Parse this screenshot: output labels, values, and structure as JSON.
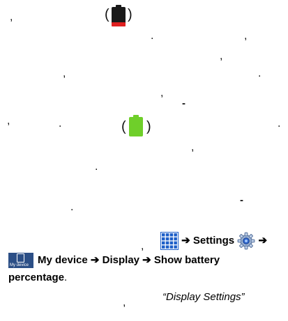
{
  "marks": {
    "comma": ",",
    "period": ".",
    "dash": "-",
    "paren_open": "(",
    "paren_close": ")"
  },
  "icons": {
    "battery_low": "battery-low-icon",
    "battery_full": "battery-full-icon",
    "apps": "apps-grid-icon",
    "settings": "settings-gear-icon",
    "my_device": "my-device-icon"
  },
  "colors": {
    "battery_low_fill": "#e02020",
    "battery_low_body": "#1a1a1a",
    "battery_full_fill": "#6fcf2a",
    "apps_blue": "#1e5fc8",
    "my_device_bg": "#2c4f86"
  },
  "instructions": {
    "arrow": "➔",
    "settings_label": "Settings",
    "my_device_icon_text": "My device",
    "my_device_label": "My device",
    "display_label": "Display",
    "show_battery_label": "Show battery",
    "percentage_label": "percentage",
    "period": ".",
    "comma": ",",
    "display_settings_quote": "“Display Settings”"
  }
}
